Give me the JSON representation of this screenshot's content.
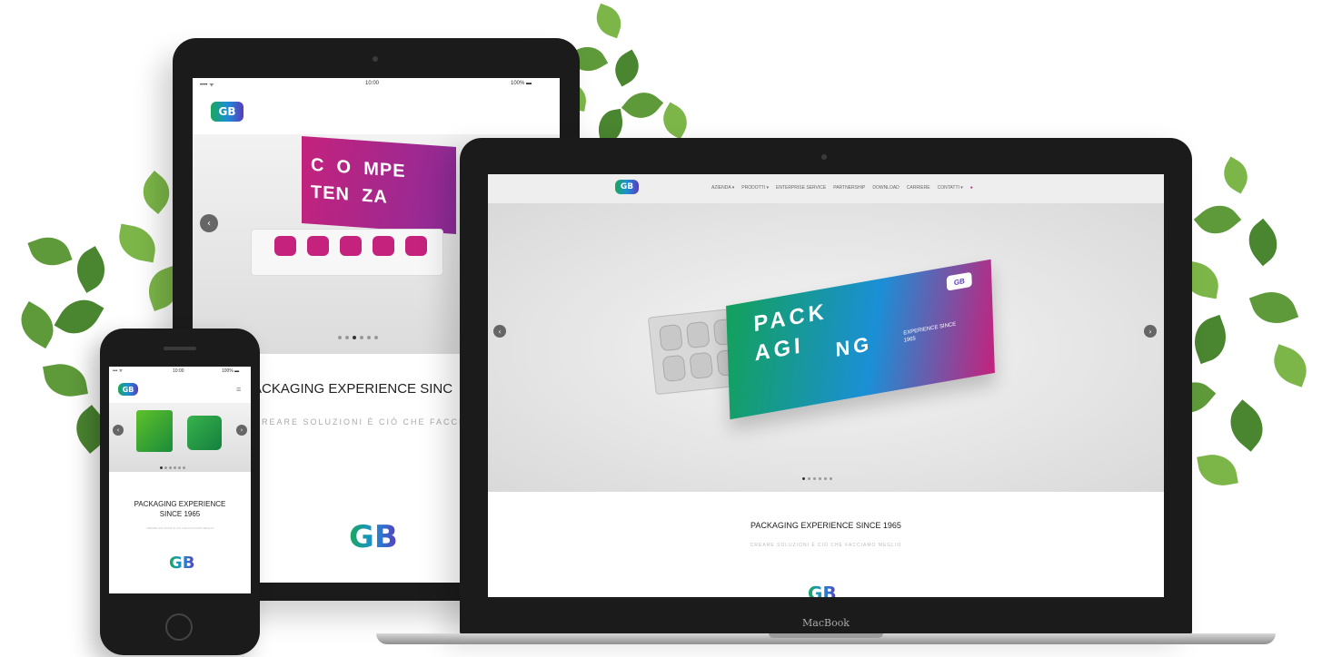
{
  "laptop": {
    "brand_label": "MacBook",
    "nav": {
      "items": [
        "AZIENDA ▾",
        "PRODOTTI ▾",
        "ENTERPRISE SERVICE",
        "PARTNERSHIP",
        "DOWNLOAD",
        "CARRIERE",
        "CONTATTI ▾"
      ]
    },
    "hero": {
      "box_line1": "PACK",
      "box_line2": "AGI",
      "box_line3": "NG",
      "box_side": "EXPERIENCE SINCE 1965"
    },
    "tagline": {
      "title": "PACKAGING EXPERIENCE SINCE 1965",
      "subtitle": "CREARE SOLUZIONI È CIÒ CHE FACCIAMO MEGLIO"
    }
  },
  "tablet": {
    "status": {
      "carrier": "•••• ᯤ",
      "time": "10:00",
      "battery": "100% ▬"
    },
    "hero": {
      "word_line1": "C  O  MPE",
      "word_line2": "TEN  ZA"
    },
    "tagline": {
      "title": "ACKAGING EXPERIENCE SINC",
      "subtitle": "REARE SOLUZIONI È CIÒ CHE FACCIAMO"
    }
  },
  "phone": {
    "status": {
      "carrier": "••• ᯤ",
      "time": "10:00",
      "battery": "100% ▬"
    },
    "tagline": {
      "title": "PACKAGING EXPERIENCE SINCE 1965",
      "subtitle": "CREARE SOLUZIONI È CIÒ CHE FACCIAMO MEGLIO"
    }
  },
  "logo_text": "GB",
  "colors": {
    "green": "#1aa85a",
    "blue": "#1b8fd6",
    "purple": "#5b3bbd",
    "magenta": "#c4227c",
    "device_dark": "#1b1b1b"
  }
}
